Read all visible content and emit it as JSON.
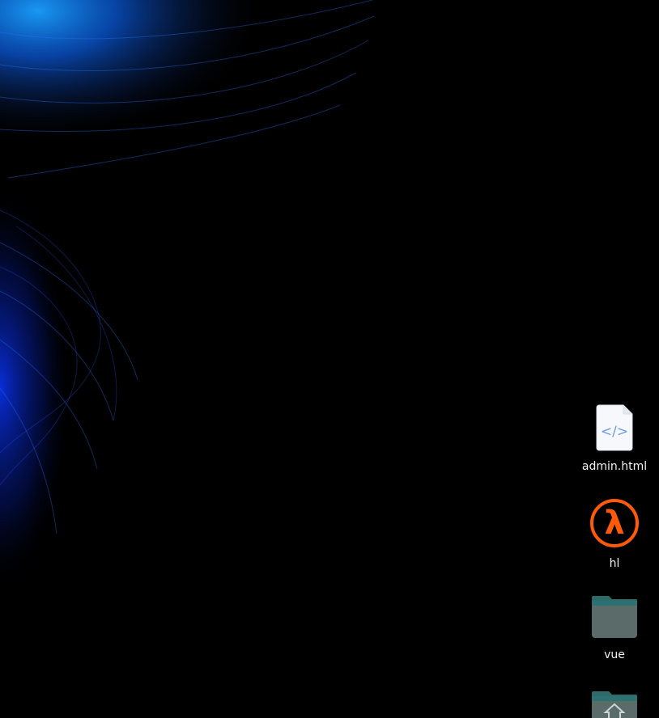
{
  "desktop": {
    "wallpaper": {
      "description_colors": [
        "#0033cc",
        "#0a66ff",
        "#1a9fff",
        "#0d3b66"
      ],
      "background": "#000000"
    },
    "icons": [
      {
        "label": "admin.html",
        "icon": "html-file-icon",
        "color": "#7aa6e8"
      },
      {
        "label": "hl",
        "icon": "half-life-lambda-icon",
        "color": "#ff5a0a"
      },
      {
        "label": "vue",
        "icon": "folder-icon",
        "color": "#4f7a78"
      },
      {
        "label": "",
        "icon": "home-folder-icon",
        "color": "#4f7a78"
      }
    ]
  }
}
